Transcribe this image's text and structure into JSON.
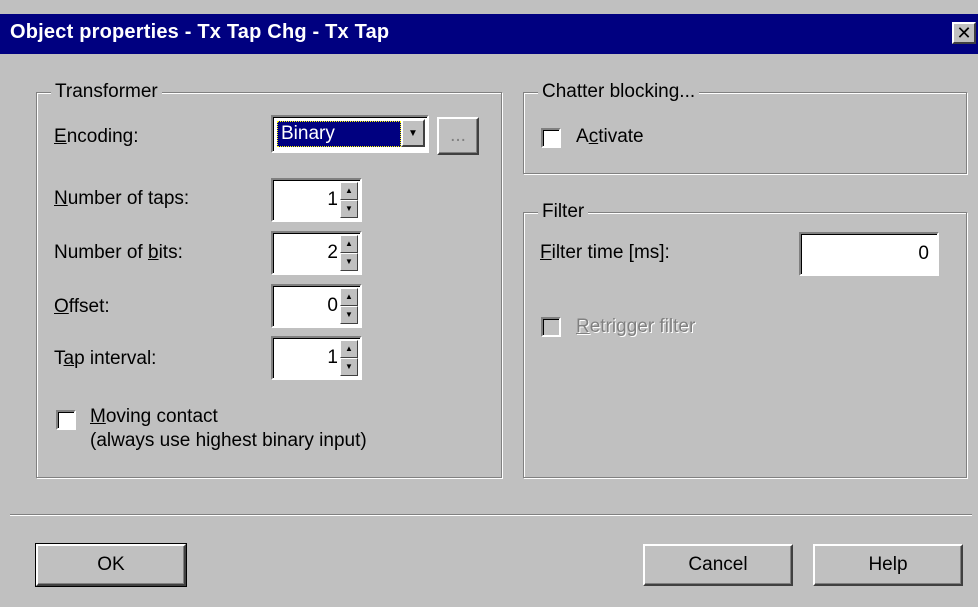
{
  "window": {
    "title": "Object properties - Tx Tap Chg - Tx Tap",
    "close_glyph": "✕"
  },
  "transformer": {
    "group_title": "Transformer",
    "encoding": {
      "label_u": "E",
      "label_rest": "ncoding:",
      "value": "Binary",
      "browse_label": "..."
    },
    "taps": {
      "label_u": "N",
      "label_rest": "umber of taps:",
      "value": "1"
    },
    "bits": {
      "label_pre": "Number of ",
      "label_u": "b",
      "label_rest": "its:",
      "value": "2"
    },
    "offset": {
      "label_u": "O",
      "label_rest": "ffset:",
      "value": "0"
    },
    "interval": {
      "label_pre": "T",
      "label_u": "a",
      "label_rest": "p interval:",
      "value": "1"
    },
    "moving_contact": {
      "label_u": "M",
      "label_rest": "oving contact",
      "sub": "(always use highest binary input)",
      "checked": false
    }
  },
  "chatter": {
    "group_title": "Chatter blocking...",
    "activate": {
      "label_pre": "A",
      "label_u": "c",
      "label_rest": "tivate",
      "checked": false
    }
  },
  "filter": {
    "group_title": "Filter",
    "time": {
      "label_u": "F",
      "label_rest": "ilter time [ms]:",
      "value": "0"
    },
    "retrigger": {
      "label_u": "R",
      "label_rest": "etrigger filter",
      "checked": false,
      "enabled": false
    }
  },
  "buttons": {
    "ok": "OK",
    "cancel": "Cancel",
    "help": "Help"
  },
  "icons": {
    "spin_up": "▲",
    "spin_down": "▼",
    "dropdown": "▼"
  }
}
